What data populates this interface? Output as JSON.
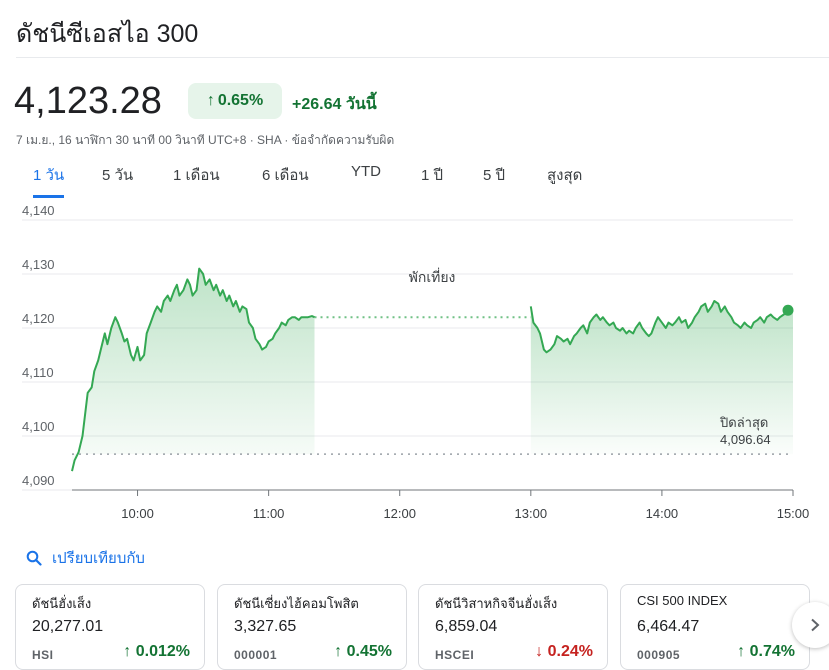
{
  "header": {
    "title": "ดัชนีซีเอสไอ 300"
  },
  "quote": {
    "price": "4,123.28",
    "change_pct": "0.65%",
    "change_abs": "+26.64 วันนี้",
    "meta": "7 เม.ย., 16 นาฬิกา 30 นาที 00 วินาที UTC+8 · SHA · ข้อจำกัดความรับผิด"
  },
  "tabs": [
    {
      "label": "1 วัน",
      "active": true
    },
    {
      "label": "5 วัน",
      "active": false
    },
    {
      "label": "1 เดือน",
      "active": false
    },
    {
      "label": "6 เดือน",
      "active": false
    },
    {
      "label": "YTD",
      "active": false
    },
    {
      "label": "1 ปี",
      "active": false
    },
    {
      "label": "5 ปี",
      "active": false
    },
    {
      "label": "สูงสุด",
      "active": false
    }
  ],
  "chart_data": {
    "type": "area",
    "xlabel": "",
    "ylabel": "",
    "ylim": [
      4090,
      4140
    ],
    "yticks": [
      "4,140",
      "4,130",
      "4,120",
      "4,110",
      "4,100",
      "4,090"
    ],
    "ytick_values": [
      4140,
      4130,
      4120,
      4110,
      4100,
      4090
    ],
    "xticks": [
      "10:00",
      "11:00",
      "12:00",
      "13:00",
      "14:00",
      "15:00"
    ],
    "xtick_values": [
      10,
      11,
      12,
      13,
      14,
      15
    ],
    "grid": true,
    "break_label": "พักเที่ยง",
    "break_range": [
      11.5,
      13.0
    ],
    "previous_close_label": "ปิดล่าสุด",
    "previous_close_value_label": "4,096.64",
    "previous_close": 4096.64,
    "line_color": "#34a853",
    "morning": [
      [
        9.5,
        4093.5
      ],
      [
        9.52,
        4095.5
      ],
      [
        9.55,
        4097
      ],
      [
        9.58,
        4100
      ],
      [
        9.6,
        4104
      ],
      [
        9.62,
        4108
      ],
      [
        9.65,
        4109
      ],
      [
        9.67,
        4112
      ],
      [
        9.7,
        4114
      ],
      [
        9.72,
        4116
      ],
      [
        9.75,
        4119
      ],
      [
        9.77,
        4117
      ],
      [
        9.8,
        4120
      ],
      [
        9.83,
        4122
      ],
      [
        9.85,
        4121
      ],
      [
        9.88,
        4119
      ],
      [
        9.9,
        4117.5
      ],
      [
        9.92,
        4118
      ],
      [
        9.95,
        4115
      ],
      [
        9.97,
        4114
      ],
      [
        10.0,
        4116.5
      ],
      [
        10.02,
        4114
      ],
      [
        10.05,
        4115
      ],
      [
        10.07,
        4119
      ],
      [
        10.1,
        4121
      ],
      [
        10.13,
        4123
      ],
      [
        10.15,
        4124
      ],
      [
        10.18,
        4123
      ],
      [
        10.2,
        4125
      ],
      [
        10.23,
        4126
      ],
      [
        10.25,
        4125
      ],
      [
        10.28,
        4127
      ],
      [
        10.3,
        4128
      ],
      [
        10.32,
        4126
      ],
      [
        10.35,
        4127
      ],
      [
        10.38,
        4129
      ],
      [
        10.4,
        4128
      ],
      [
        10.42,
        4126
      ],
      [
        10.45,
        4127
      ],
      [
        10.47,
        4131
      ],
      [
        10.5,
        4130
      ],
      [
        10.52,
        4128
      ],
      [
        10.55,
        4129
      ],
      [
        10.58,
        4127
      ],
      [
        10.6,
        4128
      ],
      [
        10.63,
        4126
      ],
      [
        10.65,
        4127
      ],
      [
        10.68,
        4125
      ],
      [
        10.7,
        4126
      ],
      [
        10.73,
        4124
      ],
      [
        10.75,
        4125
      ],
      [
        10.78,
        4123
      ],
      [
        10.8,
        4124
      ],
      [
        10.83,
        4123.5
      ],
      [
        10.85,
        4121
      ],
      [
        10.88,
        4120
      ],
      [
        10.9,
        4118
      ],
      [
        10.93,
        4117
      ],
      [
        10.95,
        4116
      ],
      [
        10.98,
        4116.5
      ],
      [
        11.0,
        4117.5
      ],
      [
        11.03,
        4118
      ],
      [
        11.05,
        4119
      ],
      [
        11.08,
        4120
      ],
      [
        11.1,
        4121
      ],
      [
        11.13,
        4120.5
      ],
      [
        11.15,
        4121.5
      ],
      [
        11.18,
        4122
      ],
      [
        11.2,
        4122
      ],
      [
        11.23,
        4121.5
      ],
      [
        11.25,
        4122
      ],
      [
        11.28,
        4122
      ],
      [
        11.3,
        4122
      ],
      [
        11.33,
        4122.2
      ],
      [
        11.35,
        4122
      ]
    ],
    "afternoon": [
      [
        13.0,
        4124
      ],
      [
        13.02,
        4121
      ],
      [
        13.05,
        4120
      ],
      [
        13.07,
        4119
      ],
      [
        13.1,
        4116
      ],
      [
        13.12,
        4115.5
      ],
      [
        13.15,
        4116
      ],
      [
        13.18,
        4117
      ],
      [
        13.2,
        4118.5
      ],
      [
        13.23,
        4118
      ],
      [
        13.25,
        4117.5
      ],
      [
        13.28,
        4118
      ],
      [
        13.3,
        4117
      ],
      [
        13.33,
        4118.5
      ],
      [
        13.35,
        4119
      ],
      [
        13.38,
        4120
      ],
      [
        13.4,
        4120.5
      ],
      [
        13.43,
        4119
      ],
      [
        13.45,
        4121
      ],
      [
        13.48,
        4122
      ],
      [
        13.5,
        4122.5
      ],
      [
        13.53,
        4121.5
      ],
      [
        13.55,
        4122
      ],
      [
        13.58,
        4121
      ],
      [
        13.6,
        4120.5
      ],
      [
        13.63,
        4121
      ],
      [
        13.65,
        4120
      ],
      [
        13.68,
        4119.5
      ],
      [
        13.7,
        4120
      ],
      [
        13.73,
        4119
      ],
      [
        13.75,
        4119.5
      ],
      [
        13.78,
        4119
      ],
      [
        13.8,
        4120
      ],
      [
        13.83,
        4121
      ],
      [
        13.85,
        4120
      ],
      [
        13.88,
        4119
      ],
      [
        13.9,
        4118.5
      ],
      [
        13.92,
        4119
      ],
      [
        13.95,
        4121
      ],
      [
        13.97,
        4122
      ],
      [
        14.0,
        4121
      ],
      [
        14.03,
        4120
      ],
      [
        14.05,
        4121
      ],
      [
        14.08,
        4120.5
      ],
      [
        14.1,
        4121
      ],
      [
        14.13,
        4122
      ],
      [
        14.15,
        4121
      ],
      [
        14.18,
        4121.5
      ],
      [
        14.2,
        4120
      ],
      [
        14.23,
        4121
      ],
      [
        14.25,
        4122
      ],
      [
        14.28,
        4123
      ],
      [
        14.3,
        4124
      ],
      [
        14.33,
        4124.5
      ],
      [
        14.35,
        4123
      ],
      [
        14.38,
        4124
      ],
      [
        14.4,
        4125
      ],
      [
        14.43,
        4124.5
      ],
      [
        14.45,
        4123
      ],
      [
        14.48,
        4124
      ],
      [
        14.5,
        4123
      ],
      [
        14.53,
        4122
      ],
      [
        14.55,
        4121
      ],
      [
        14.58,
        4120.5
      ],
      [
        14.6,
        4120
      ],
      [
        14.63,
        4121
      ],
      [
        14.65,
        4120.5
      ],
      [
        14.68,
        4120
      ],
      [
        14.7,
        4121
      ],
      [
        14.73,
        4121.5
      ],
      [
        14.75,
        4122
      ],
      [
        14.78,
        4121
      ],
      [
        14.8,
        4122
      ],
      [
        14.83,
        4122.5
      ],
      [
        14.85,
        4122
      ],
      [
        14.88,
        4121.5
      ],
      [
        14.9,
        4122
      ],
      [
        14.93,
        4122.5
      ],
      [
        14.95,
        4123
      ],
      [
        14.97,
        4122.8
      ],
      [
        15.0,
        4123.28
      ]
    ]
  },
  "compare": {
    "label": "เปรียบเทียบกับ"
  },
  "cards": [
    {
      "name": "ดัชนีฮั่งเส็ง",
      "value": "20,277.01",
      "ticker": "HSI",
      "change": "0.012%",
      "dir": "up"
    },
    {
      "name": "ดัชนีเซี่ยงไฮ้คอมโพสิต",
      "value": "3,327.65",
      "ticker": "000001",
      "change": "0.45%",
      "dir": "up"
    },
    {
      "name": "ดัชนีวิสาหกิจจีนฮั่งเส็ง",
      "value": "6,859.04",
      "ticker": "HSCEI",
      "change": "0.24%",
      "dir": "down"
    },
    {
      "name": "CSI 500 INDEX",
      "value": "6,464.47",
      "ticker": "000905",
      "change": "0.74%",
      "dir": "up"
    }
  ]
}
